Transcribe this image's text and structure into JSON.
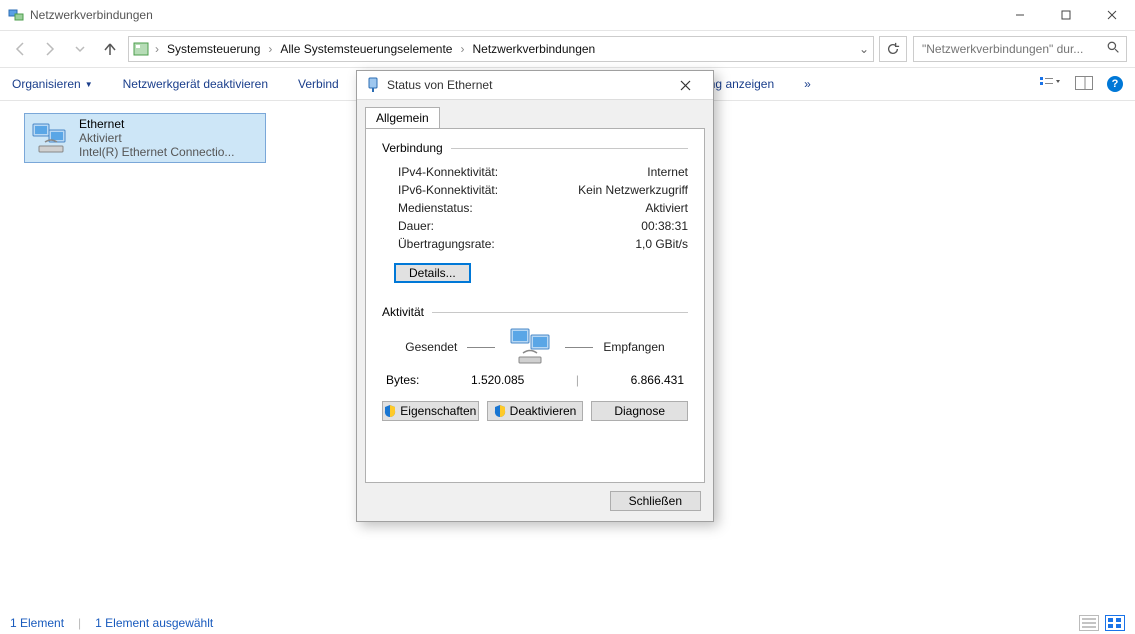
{
  "window": {
    "title": "Netzwerkverbindungen",
    "min": "–",
    "max": "☐",
    "close": "✕"
  },
  "breadcrumbs": [
    "Systemsteuerung",
    "Alle Systemsteuerungselemente",
    "Netzwerkverbindungen"
  ],
  "search": {
    "placeholder": "\"Netzwerkverbindungen\" dur..."
  },
  "toolbar": {
    "organize": "Organisieren",
    "disable_device": "Netzwerkgerät deaktivieren",
    "connection_truncated": "Verbind",
    "show_connection_truncated": "ndung anzeigen",
    "more": "»"
  },
  "connection_item": {
    "name": "Ethernet",
    "state": "Aktiviert",
    "device": "Intel(R) Ethernet Connectio..."
  },
  "statusbar": {
    "count": "1 Element",
    "selected": "1 Element ausgewählt"
  },
  "dialog": {
    "title": "Status von Ethernet",
    "tab": "Allgemein",
    "group_connection": "Verbindung",
    "rows": {
      "ipv4_label": "IPv4-Konnektivität:",
      "ipv4_value": "Internet",
      "ipv6_label": "IPv6-Konnektivität:",
      "ipv6_value": "Kein Netzwerkzugriff",
      "media_label": "Medienstatus:",
      "media_value": "Aktiviert",
      "duration_label": "Dauer:",
      "duration_value": "00:38:31",
      "speed_label": "Übertragungsrate:",
      "speed_value": "1,0 GBit/s"
    },
    "details_btn": "Details...",
    "group_activity": "Aktivität",
    "sent_label": "Gesendet",
    "recv_label": "Empfangen",
    "bytes_label": "Bytes:",
    "bytes_sent": "1.520.085",
    "bytes_recv": "6.866.431",
    "btn_properties": "Eigenschaften",
    "btn_disable": "Deaktivieren",
    "btn_diagnose": "Diagnose",
    "btn_close": "Schließen"
  }
}
